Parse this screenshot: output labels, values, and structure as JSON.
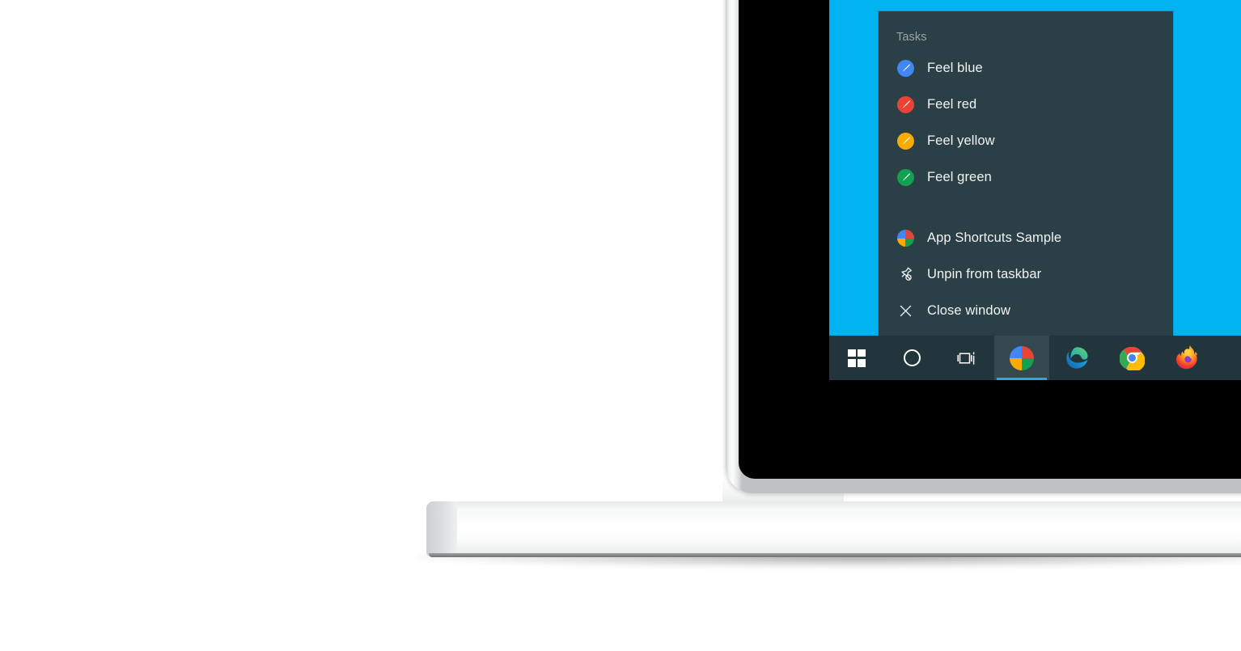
{
  "scene": {
    "device": "laptop",
    "wallpaper_color": "#00b3f0",
    "screen_bezel_color": "#000000",
    "chassis_color": "#f2f3f3"
  },
  "jumplist": {
    "background_color": "#2b3f46",
    "header": "Tasks",
    "tasks": [
      {
        "label": "Feel blue",
        "icon": "paintbrush-icon",
        "color": "#4285f4"
      },
      {
        "label": "Feel red",
        "icon": "paintbrush-icon",
        "color": "#ea4335"
      },
      {
        "label": "Feel yellow",
        "icon": "paintbrush-icon",
        "color": "#f9ab00"
      },
      {
        "label": "Feel green",
        "icon": "paintbrush-icon",
        "color": "#12a150"
      }
    ],
    "actions": [
      {
        "label": "App Shortcuts Sample",
        "icon": "app-pinwheel-icon"
      },
      {
        "label": "Unpin from taskbar",
        "icon": "unpin-icon"
      },
      {
        "label": "Close window",
        "icon": "close-icon"
      }
    ]
  },
  "taskbar": {
    "background_color": "#23353c",
    "active_indicator_color": "#29a8e0",
    "items": [
      {
        "name": "start-button",
        "icon": "windows-logo-icon",
        "active": false
      },
      {
        "name": "cortana-button",
        "icon": "cortana-circle-icon",
        "active": false
      },
      {
        "name": "task-view-button",
        "icon": "task-view-icon",
        "active": false
      },
      {
        "name": "app-shortcuts-sample",
        "icon": "app-pinwheel-icon",
        "active": true
      },
      {
        "name": "microsoft-edge",
        "icon": "edge-icon",
        "active": false
      },
      {
        "name": "google-chrome",
        "icon": "chrome-icon",
        "active": false
      },
      {
        "name": "mozilla-firefox",
        "icon": "firefox-icon",
        "active": false
      }
    ]
  }
}
